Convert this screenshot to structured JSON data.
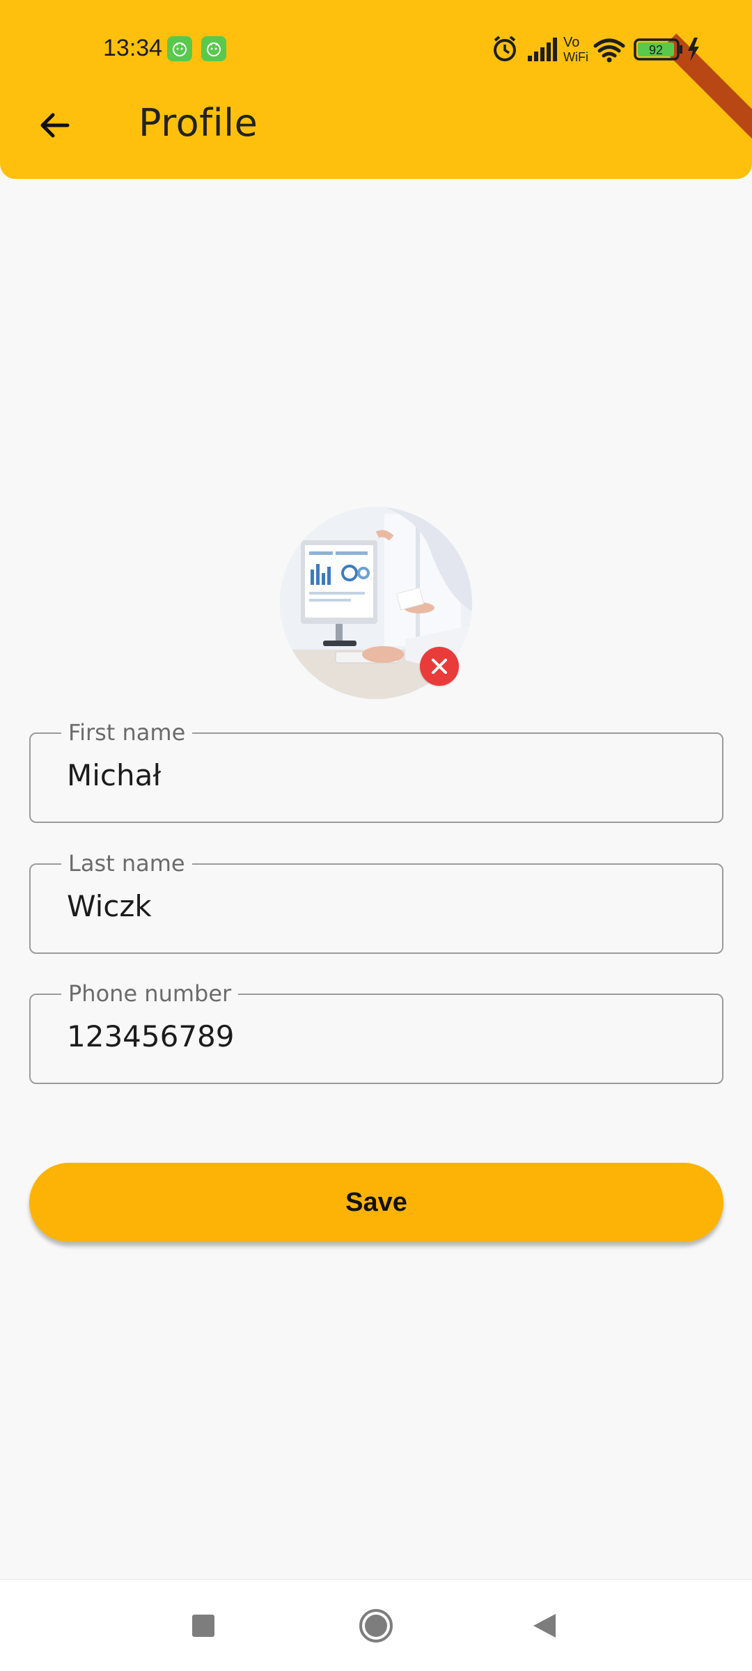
{
  "status_bar": {
    "time": "13:34",
    "battery": "92",
    "wifi_label": "Vo WiFi"
  },
  "header": {
    "title": "Profile",
    "back_icon": "arrow-left-icon"
  },
  "avatar": {
    "remove_icon": "close-icon"
  },
  "form": {
    "first_name": {
      "label": "First name",
      "value": "Michał"
    },
    "last_name": {
      "label": "Last name",
      "value": "Wiczk"
    },
    "phone": {
      "label": "Phone number",
      "value": "123456789"
    }
  },
  "save_button": {
    "label": "Save"
  },
  "colors": {
    "header": "#fec00c",
    "save_button": "#fdb305",
    "remove_badge": "#ea3b3b"
  },
  "nav": {
    "recent_icon": "square-icon",
    "home_icon": "circle-icon",
    "back_icon": "triangle-back-icon"
  }
}
